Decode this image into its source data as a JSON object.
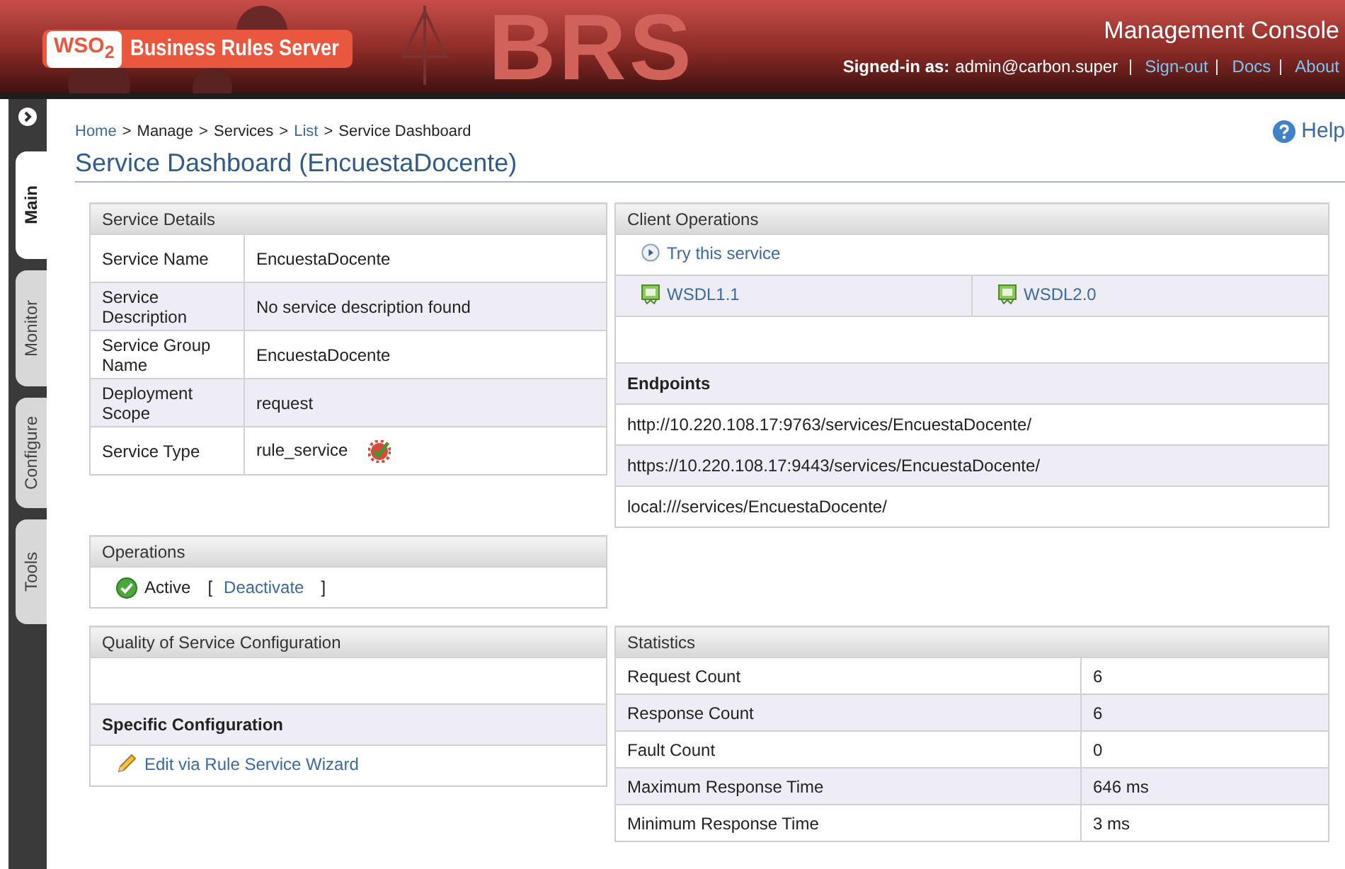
{
  "header": {
    "logo": "WSO$_{2}$",
    "product": "Business Rules Server",
    "banner_text": "BRS",
    "title": "Management Console",
    "signed_in_label": "Signed-in as:",
    "user": "admin@carbon.super",
    "links": [
      "Sign-out",
      "Docs",
      "About"
    ]
  },
  "sidebar": {
    "tabs": [
      {
        "label": "Main",
        "selected": true
      },
      {
        "label": "Monitor",
        "selected": false
      },
      {
        "label": "Configure",
        "selected": false
      },
      {
        "label": "Tools",
        "selected": false
      }
    ]
  },
  "breadcrumb": [
    {
      "text": "Home",
      "kind": "link"
    },
    {
      "text": ">",
      "kind": "separator"
    },
    {
      "text": "Manage",
      "kind": "text"
    },
    {
      "text": ">",
      "kind": "separator"
    },
    {
      "text": "Services",
      "kind": "text"
    },
    {
      "text": ">",
      "kind": "separator"
    },
    {
      "text": "List",
      "kind": "link"
    },
    {
      "text": ">",
      "kind": "separator"
    },
    {
      "text": "Service Dashboard",
      "kind": "text"
    }
  ],
  "help": "Help",
  "page_title": "Service Dashboard (EncuestaDocente)",
  "service_details": {
    "title": "Service Details",
    "rows": [
      {
        "label": "Service Name",
        "value": "EncuestaDocente",
        "kind": "plain"
      },
      {
        "label": "Service Description",
        "value": "No service description found",
        "kind": "plain"
      },
      {
        "label": "Service Group Name",
        "value": "EncuestaDocente",
        "kind": "plain"
      },
      {
        "label": "Deployment Scope",
        "value": "request",
        "kind": "plain"
      },
      {
        "label": "Service Type",
        "value": "rule_service",
        "kind": "badge"
      }
    ]
  },
  "client_operations": {
    "title": "Client Operations",
    "try_link": "Try this service",
    "wsdl_links": [
      "WSDL1.1",
      "WSDL2.0"
    ],
    "endpoints_title": "Endpoints",
    "endpoints": [
      "http://10.220.108.17:9763/services/EncuestaDocente/",
      "https://10.220.108.17:9443/services/EncuestaDocente/",
      "local:///services/EncuestaDocente/"
    ]
  },
  "operations": {
    "title": "Operations",
    "active": true,
    "status": "Active",
    "bracket_open": "[",
    "action": "Deactivate",
    "bracket_close": "]"
  },
  "qos": {
    "title": "Quality of Service Configuration",
    "section": "Specific Configuration",
    "link": "Edit via Rule Service Wizard"
  },
  "statistics": {
    "title": "Statistics",
    "rows": [
      {
        "label": "Request Count",
        "value": "6"
      },
      {
        "label": "Response Count",
        "value": "6"
      },
      {
        "label": "Fault Count",
        "value": "0"
      },
      {
        "label": "Maximum Response Time",
        "value": "646 ms"
      },
      {
        "label": "Minimum Response Time",
        "value": "3 ms"
      }
    ]
  }
}
